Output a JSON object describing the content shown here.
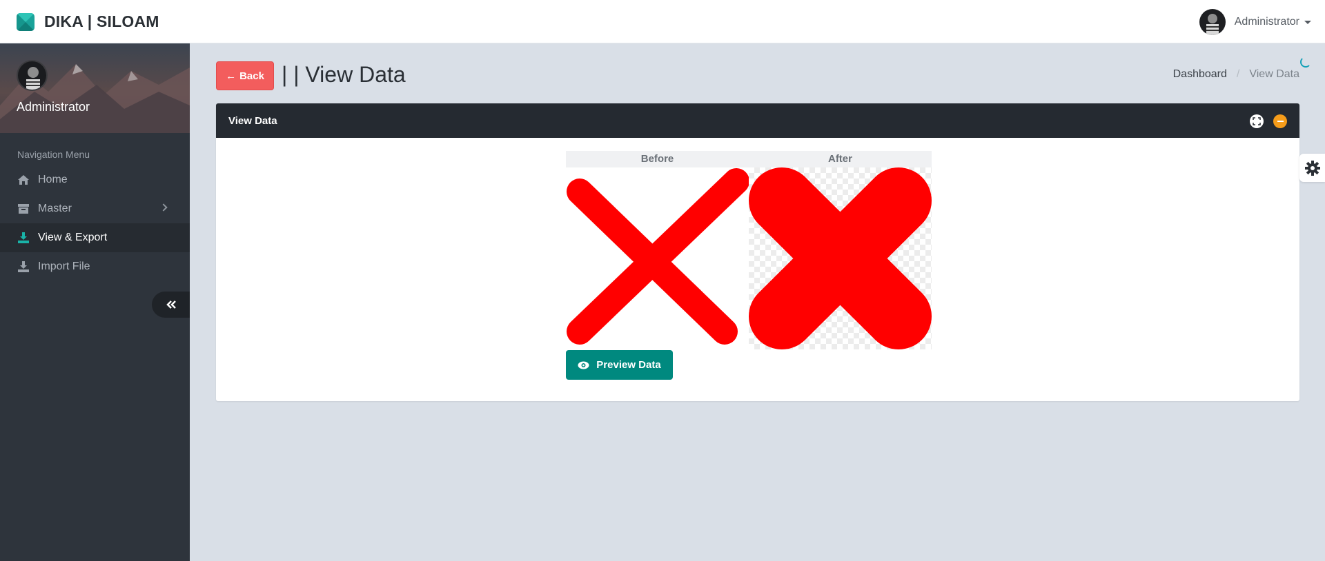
{
  "header": {
    "brand": "DIKA | SILOAM",
    "user_name": "Administrator"
  },
  "sidebar": {
    "user_name": "Administrator",
    "nav_title": "Navigation Menu",
    "items": [
      {
        "label": "Home",
        "icon": "home-icon"
      },
      {
        "label": "Master",
        "icon": "archive-icon"
      },
      {
        "label": "View & Export",
        "icon": "download-icon",
        "active": true
      },
      {
        "label": "Import File",
        "icon": "download-icon"
      }
    ]
  },
  "page": {
    "back_label": "Back",
    "title": "| | View Data",
    "breadcrumb": [
      "Dashboard",
      "View Data"
    ]
  },
  "panel": {
    "title": "View Data",
    "before_label": "Before",
    "after_label": "After",
    "preview_label": "Preview Data"
  },
  "colors": {
    "accent": "#00897f",
    "danger": "#f35d5d",
    "warning": "#f59c1a",
    "sidebar_bg": "#2e343c",
    "x_mark": "#ff0000"
  }
}
